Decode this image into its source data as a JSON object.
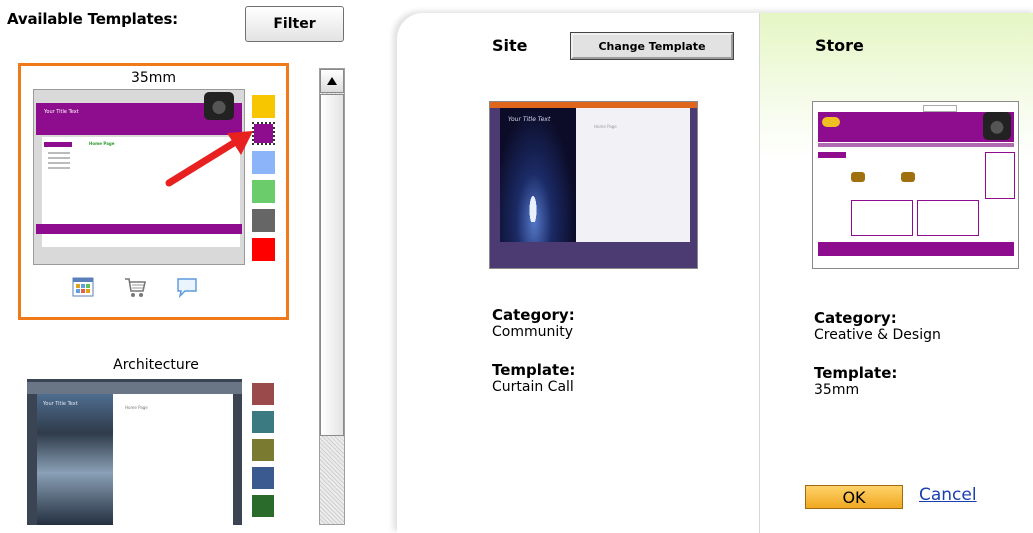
{
  "left_panel": {
    "title": "Available Templates:",
    "filter_label": "Filter",
    "templates": [
      {
        "name": "35mm",
        "thumbnail_title": "Your Title Text",
        "thumbnail_heading": "Home Page",
        "selected": true,
        "swatches": [
          "#f7c600",
          "#8e0d8e",
          "#8cb4f8",
          "#6acc6a",
          "#666666",
          "#ff0000"
        ],
        "selected_swatch": "#8e0d8e",
        "icons": [
          "calendar-icon",
          "shopping-cart-icon",
          "speech-bubble-icon"
        ]
      },
      {
        "name": "Architecture",
        "thumbnail_title": "Your Title Text",
        "thumbnail_heading": "Home Page",
        "selected": false,
        "swatches": [
          "#9a4a4a",
          "#3a7a80",
          "#7a7a30",
          "#3a5a90",
          "#2a6a2a"
        ]
      }
    ]
  },
  "site": {
    "heading": "Site",
    "change_template_label": "Change Template",
    "thumbnail_title": "Your Title Text",
    "thumbnail_heading": "Home Page",
    "category_label": "Category:",
    "category_value": "Community",
    "template_label": "Template:",
    "template_value": "Curtain Call"
  },
  "store": {
    "heading": "Store",
    "category_label": "Category:",
    "category_value": "Creative & Design",
    "template_label": "Template:",
    "template_value": "35mm",
    "ok_label": "OK",
    "cancel_label": "Cancel"
  },
  "colors": {
    "selection_border": "#f07a1a",
    "store_accent": "#8e0d8e",
    "ok_button": "#f0a820",
    "link": "#1a3fb0"
  }
}
